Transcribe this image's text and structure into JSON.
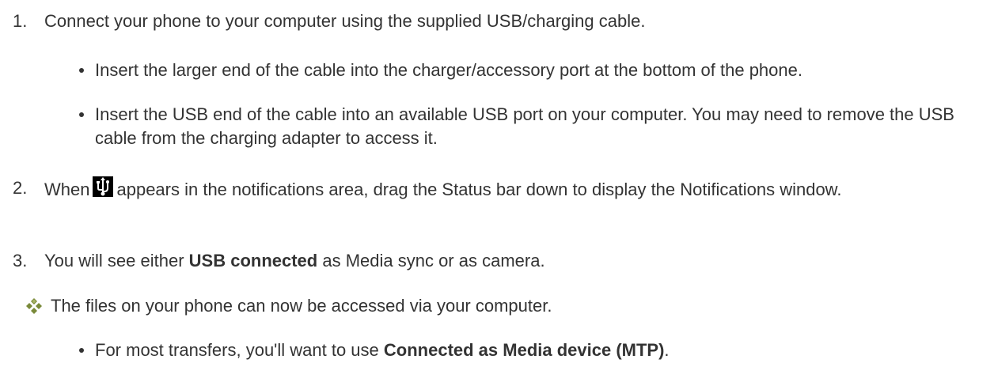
{
  "steps": [
    {
      "number": "1.",
      "text": "Connect your phone to your computer using the supplied USB/charging cable.",
      "bullets": [
        "Insert the larger end of the cable into the charger/accessory port at the bottom of the phone.",
        "Insert the USB end of the cable into an available USB port on your computer. You may need to remove the USB cable from the charging adapter to access it."
      ]
    },
    {
      "number": "2.",
      "text_before_icon": "When",
      "icon": "usb-icon",
      "text_after_icon": "appears in the notifications area, drag the Status bar down to display the Notifications window."
    },
    {
      "number": "3.",
      "text_before_bold": "You will see either ",
      "bold": "USB connected",
      "text_after_bold": " as Media sync or as camera."
    }
  ],
  "result": {
    "icon": "diamond-cluster-icon",
    "text": "The files on your phone can now be accessed via your computer.",
    "bullet": {
      "text_before_bold": "For most transfers, you'll want to use ",
      "bold": "Connected as Media device (MTP)",
      "text_after_bold": "."
    }
  }
}
